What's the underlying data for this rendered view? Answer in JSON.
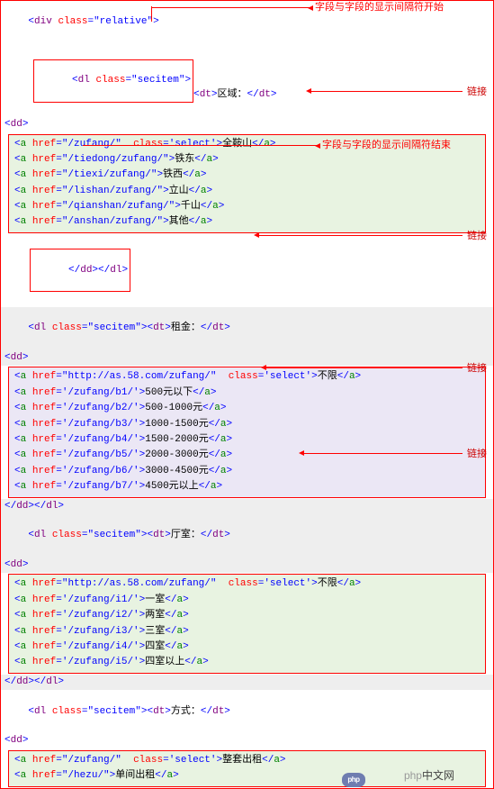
{
  "annotations": {
    "sep_start": "字段与字段的显示间隔符开始",
    "sep_end": "字段与字段的显示间隔符结束",
    "link_label": "链接"
  },
  "div_open": "div",
  "div_class": "relative",
  "dl_tag": "dl",
  "dl_class": "secitem",
  "dt_tag": "dt",
  "dd_tag": "dd",
  "a_tag": "a",
  "href_attr": "href",
  "class_attr": "class",
  "select_class": "select",
  "close_dd_dl": "</dd></dl>",
  "close_a": "</a>",
  "gt": ">",
  "lt": "<",
  "slash": "/",
  "quote": "\"",
  "squote": "'",
  "sections": [
    {
      "dt_label": "区域：",
      "links": [
        {
          "href": "\"/zufang/\"",
          "cls": "'select'",
          "text": "全鞍山"
        },
        {
          "href": "\"/tiedong/zufang/\"",
          "text": "铁东"
        },
        {
          "href": "\"/tiexi/zufang/\"",
          "text": "铁西"
        },
        {
          "href": "\"/lishan/zufang/\"",
          "text": "立山"
        },
        {
          "href": "\"/qianshan/zufang/\"",
          "text": "千山"
        },
        {
          "href": "\"/anshan/zufang/\"",
          "text": "其他"
        }
      ]
    },
    {
      "dt_label": "租金：",
      "links": [
        {
          "href": "\"http://as.58.com/zufang/\"",
          "cls": "'select'",
          "text": "不限"
        },
        {
          "href": "'/zufang/b1/'",
          "text": "500元以下"
        },
        {
          "href": "'/zufang/b2/'",
          "text": "500-1000元"
        },
        {
          "href": "'/zufang/b3/'",
          "text": "1000-1500元"
        },
        {
          "href": "'/zufang/b4/'",
          "text": "1500-2000元"
        },
        {
          "href": "'/zufang/b5/'",
          "text": "2000-3000元"
        },
        {
          "href": "'/zufang/b6/'",
          "text": "3000-4500元"
        },
        {
          "href": "'/zufang/b7/'",
          "text": "4500元以上"
        }
      ]
    },
    {
      "dt_label": "厅室：",
      "links": [
        {
          "href": "\"http://as.58.com/zufang/\"",
          "cls": "'select'",
          "text": "不限"
        },
        {
          "href": "'/zufang/i1/'",
          "text": "一室"
        },
        {
          "href": "'/zufang/i2/'",
          "text": "两室"
        },
        {
          "href": "'/zufang/i3/'",
          "text": "三室"
        },
        {
          "href": "'/zufang/i4/'",
          "text": "四室"
        },
        {
          "href": "'/zufang/i5/'",
          "text": "四室以上"
        }
      ]
    },
    {
      "dt_label": "方式：",
      "links": [
        {
          "href": "\"/zufang/\"",
          "cls": "'select'",
          "text": "整套出租"
        },
        {
          "href": "\"/hezu/\"",
          "text": "单间出租"
        }
      ]
    }
  ],
  "watermark": {
    "brand": "php",
    "cn": "中文网"
  }
}
